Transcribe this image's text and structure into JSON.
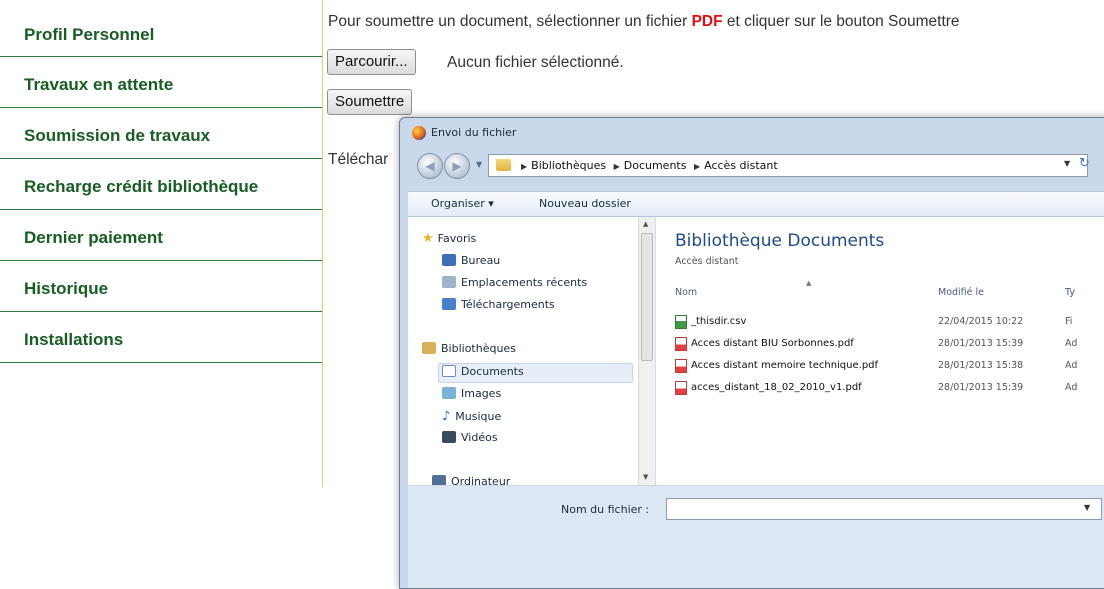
{
  "menu": {
    "items": [
      {
        "label": "Profil Personnel"
      },
      {
        "label": "Travaux en attente"
      },
      {
        "label": "Soumission de travaux"
      },
      {
        "label": "Recharge crédit bibliothèque"
      },
      {
        "label": "Dernier paiement"
      },
      {
        "label": "Historique"
      },
      {
        "label": "Installations"
      }
    ]
  },
  "form": {
    "instruction_before": "Pour soumettre un document, sélectionner un fichier ",
    "instruction_pdf": "PDF",
    "instruction_after": " et cliquer sur le bouton Soumettre",
    "browse_label": "Parcourir...",
    "no_file_text": "Aucun fichier sélectionné.",
    "submit_label": "Soumettre",
    "download_text": "Téléchar"
  },
  "dialog": {
    "title": "Envoi du fichier",
    "breadcrumbs": [
      "Bibliothèques",
      "Documents",
      "Accès distant"
    ],
    "organize_label": "Organiser ▾",
    "new_folder_label": "Nouveau dossier",
    "nav": {
      "favorites": "Favoris",
      "desktop": "Bureau",
      "recent": "Emplacements récents",
      "downloads": "Téléchargements",
      "libraries": "Bibliothèques",
      "documents": "Documents",
      "images": "Images",
      "music": "Musique",
      "videos": "Vidéos",
      "computer": "Ordinateur"
    },
    "library_title": "Bibliothèque Documents",
    "library_subtitle": "Accès distant",
    "columns": {
      "name": "Nom",
      "modified": "Modifié le",
      "type": "Ty"
    },
    "files": [
      {
        "name": "_thisdir.csv",
        "date": "22/04/2015 10:22",
        "type": "Fi",
        "kind": "csv"
      },
      {
        "name": "Acces distant BIU Sorbonnes.pdf",
        "date": "28/01/2013 15:39",
        "type": "Ad",
        "kind": "pdf"
      },
      {
        "name": "Acces distant memoire technique.pdf",
        "date": "28/01/2013 15:38",
        "type": "Ad",
        "kind": "pdf"
      },
      {
        "name": "acces_distant_18_02_2010_v1.pdf",
        "date": "28/01/2013 15:39",
        "type": "Ad",
        "kind": "pdf"
      }
    ],
    "filename_label": "Nom du fichier :",
    "filename_value": ""
  },
  "colors": {
    "menu_text": "#175d24",
    "menu_border": "#2f7a3a",
    "pdf_highlight": "#e01010",
    "dialog_frame": "#c9d8ea",
    "library_title": "#1f4b8a"
  },
  "icons": [
    "firefox-logo-icon",
    "back-arrow-icon",
    "forward-arrow-icon",
    "folder-icon",
    "refresh-icon",
    "star-icon",
    "desktop-icon",
    "recent-places-icon",
    "downloads-icon",
    "libraries-icon",
    "documents-icon",
    "images-icon",
    "music-icon",
    "videos-icon",
    "computer-icon",
    "csv-file-icon",
    "pdf-file-icon"
  ]
}
